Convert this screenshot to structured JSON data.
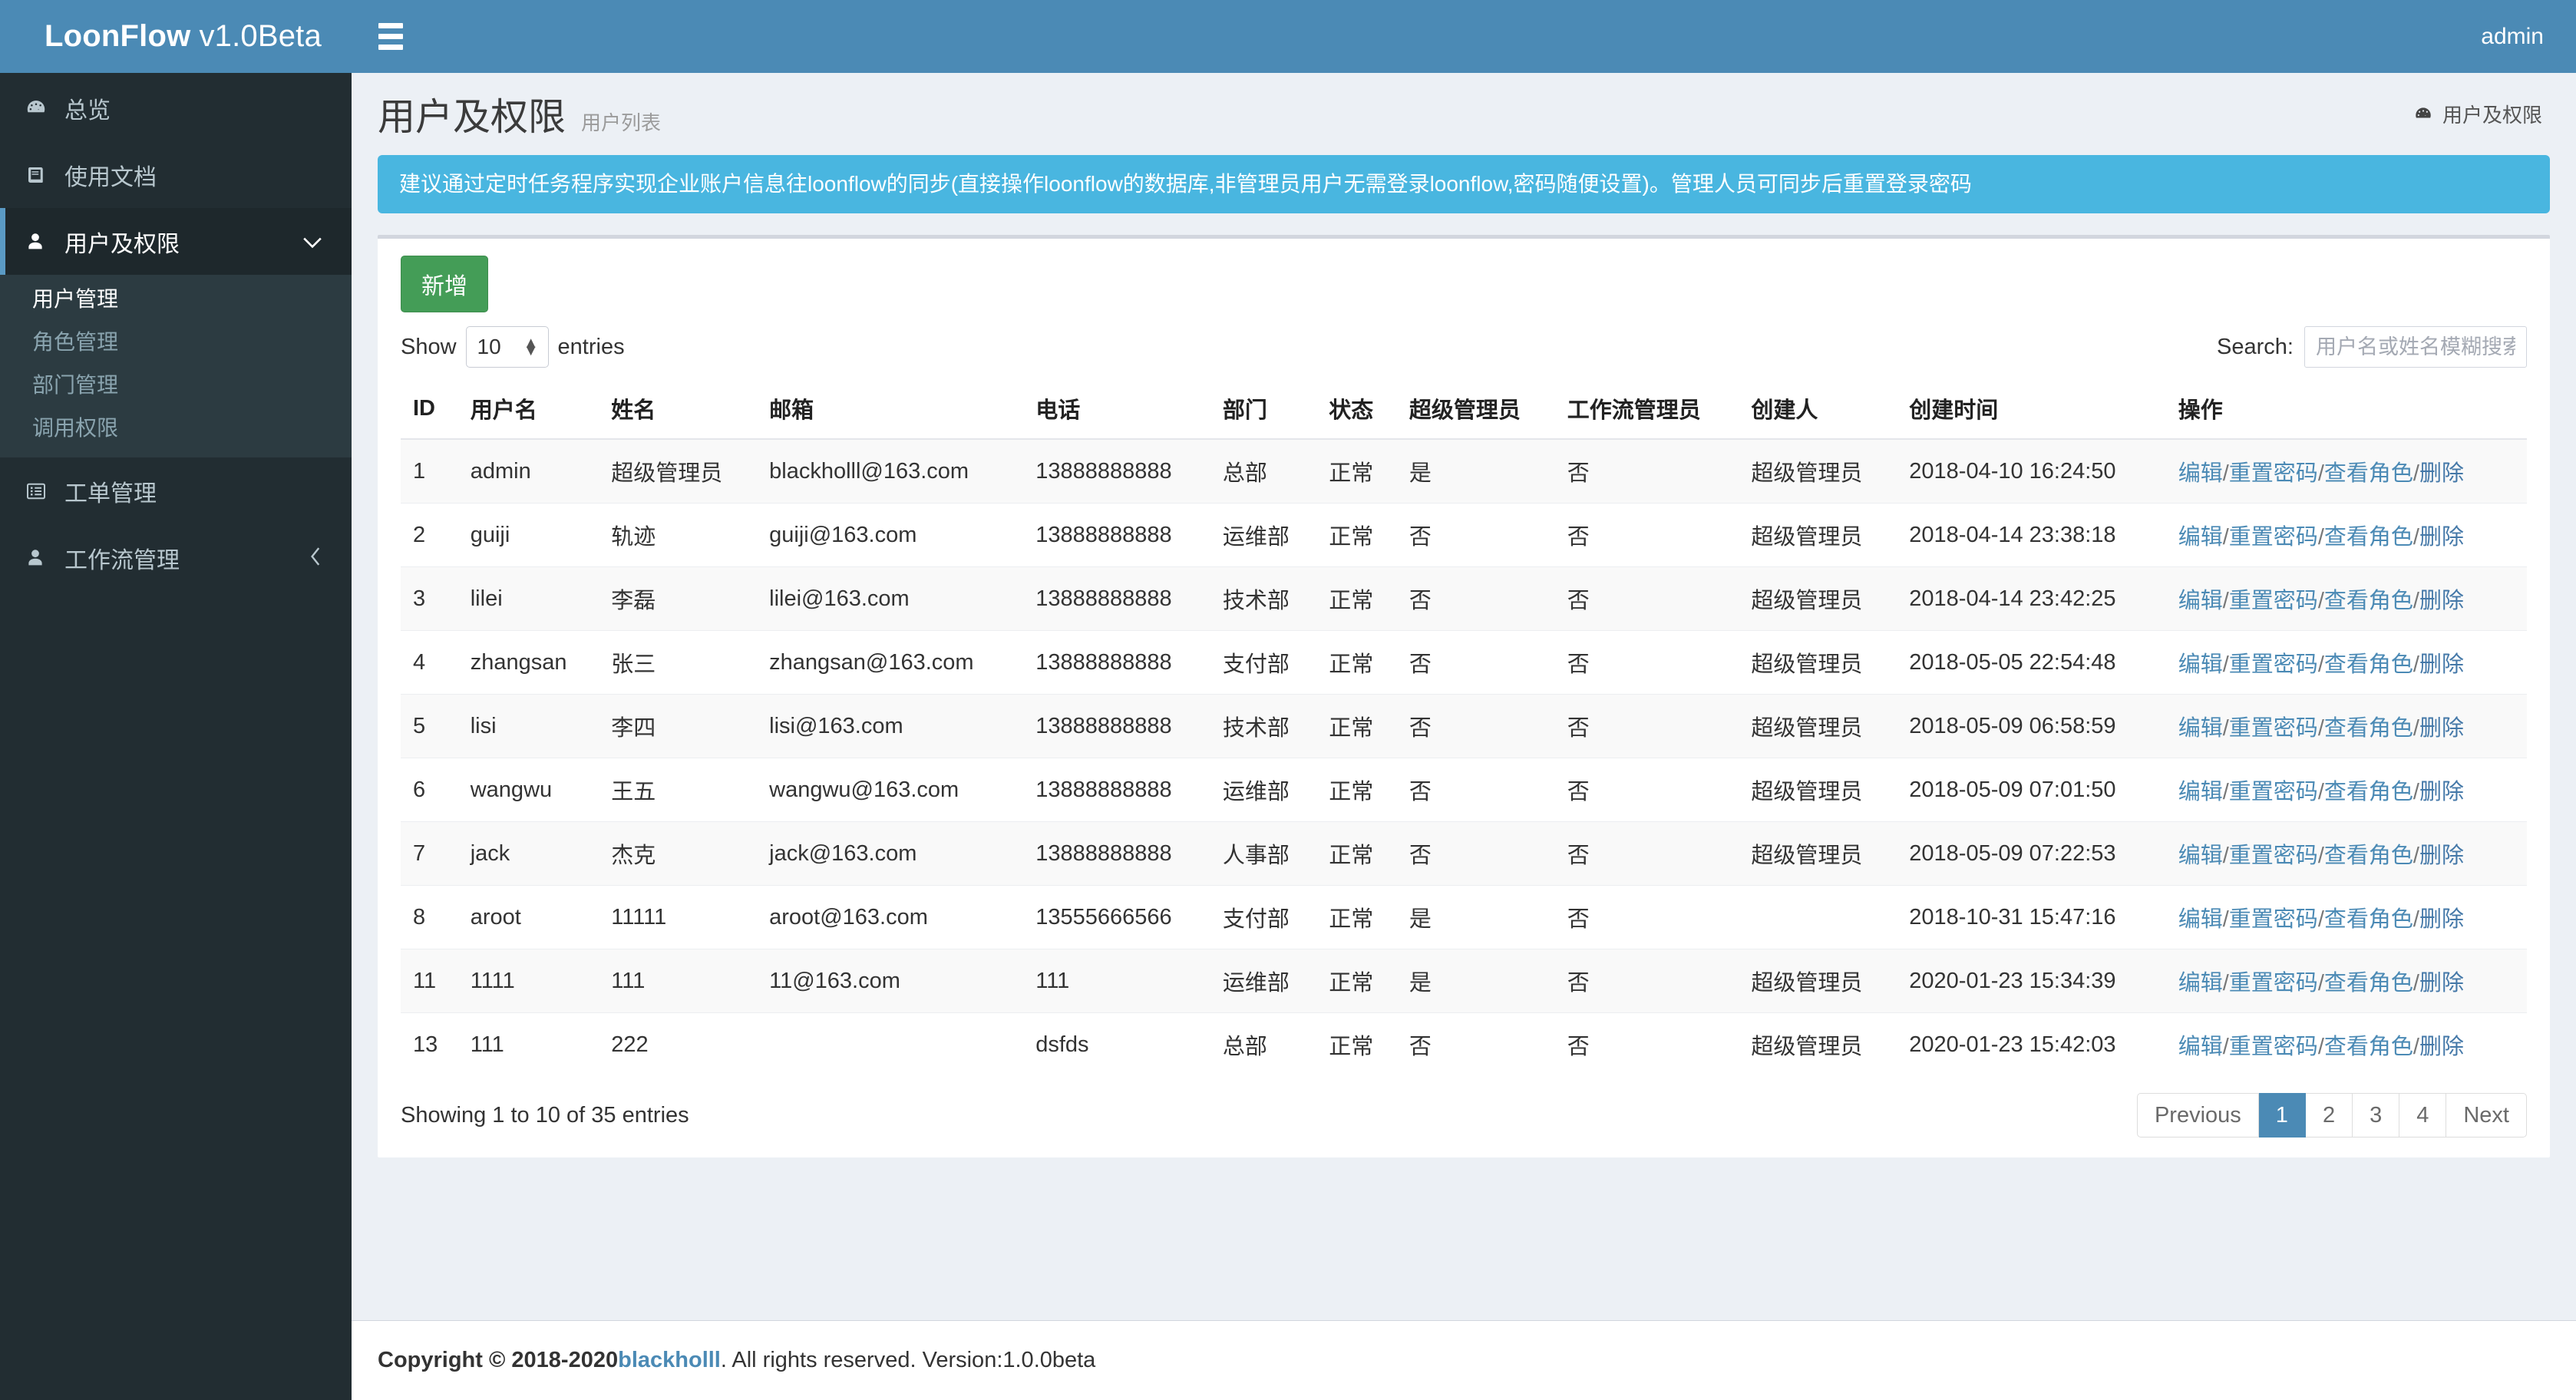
{
  "brand": {
    "name": "LoonFlow",
    "version": "v1.0Beta"
  },
  "navbar": {
    "user": "admin"
  },
  "sidebar": {
    "items": [
      {
        "label": "总览",
        "icon": "dashboard-icon",
        "state": "normal"
      },
      {
        "label": "使用文档",
        "icon": "book-icon",
        "state": "normal"
      },
      {
        "label": "用户及权限",
        "icon": "user-icon",
        "state": "active",
        "caret": "chevron-down"
      },
      {
        "label": "工单管理",
        "icon": "list-icon",
        "state": "normal"
      },
      {
        "label": "工作流管理",
        "icon": "user-icon",
        "state": "normal",
        "caret": "chevron-left"
      }
    ],
    "subitems": [
      {
        "label": "用户管理",
        "current": true
      },
      {
        "label": "角色管理",
        "current": false
      },
      {
        "label": "部门管理",
        "current": false
      },
      {
        "label": "调用权限",
        "current": false
      }
    ]
  },
  "page": {
    "title": "用户及权限",
    "subtitle": "用户列表",
    "breadcrumb": "用户及权限",
    "alert": "建议通过定时任务程序实现企业账户信息往loonflow的同步(直接操作loonflow的数据库,非管理员用户无需登录loonflow,密码随便设置)。管理人员可同步后重置登录密码"
  },
  "toolbar": {
    "add_label": "新增",
    "show_prefix": "Show",
    "show_value": "10",
    "show_suffix": "entries",
    "search_label": "Search:",
    "search_value": "",
    "search_placeholder": "用户名或姓名模糊搜索"
  },
  "table": {
    "columns": [
      "ID",
      "用户名",
      "姓名",
      "邮箱",
      "电话",
      "部门",
      "状态",
      "超级管理员",
      "工作流管理员",
      "创建人",
      "创建时间",
      "操作"
    ],
    "ops": {
      "edit": "编辑",
      "reset": "重置密码",
      "roles": "查看角色",
      "delete": "删除",
      "separator": "/"
    },
    "rows": [
      {
        "id": "1",
        "username": "admin",
        "name": "超级管理员",
        "email": "blackholll@163.com",
        "phone": "13888888888",
        "dept": "总部",
        "status": "正常",
        "is_super": "是",
        "is_wf_admin": "否",
        "creator": "超级管理员",
        "created": "2018-04-10 16:24:50"
      },
      {
        "id": "2",
        "username": "guiji",
        "name": "轨迹",
        "email": "guiji@163.com",
        "phone": "13888888888",
        "dept": "运维部",
        "status": "正常",
        "is_super": "否",
        "is_wf_admin": "否",
        "creator": "超级管理员",
        "created": "2018-04-14 23:38:18"
      },
      {
        "id": "3",
        "username": "lilei",
        "name": "李磊",
        "email": "lilei@163.com",
        "phone": "13888888888",
        "dept": "技术部",
        "status": "正常",
        "is_super": "否",
        "is_wf_admin": "否",
        "creator": "超级管理员",
        "created": "2018-04-14 23:42:25"
      },
      {
        "id": "4",
        "username": "zhangsan",
        "name": "张三",
        "email": "zhangsan@163.com",
        "phone": "13888888888",
        "dept": "支付部",
        "status": "正常",
        "is_super": "否",
        "is_wf_admin": "否",
        "creator": "超级管理员",
        "created": "2018-05-05 22:54:48"
      },
      {
        "id": "5",
        "username": "lisi",
        "name": "李四",
        "email": "lisi@163.com",
        "phone": "13888888888",
        "dept": "技术部",
        "status": "正常",
        "is_super": "否",
        "is_wf_admin": "否",
        "creator": "超级管理员",
        "created": "2018-05-09 06:58:59"
      },
      {
        "id": "6",
        "username": "wangwu",
        "name": "王五",
        "email": "wangwu@163.com",
        "phone": "13888888888",
        "dept": "运维部",
        "status": "正常",
        "is_super": "否",
        "is_wf_admin": "否",
        "creator": "超级管理员",
        "created": "2018-05-09 07:01:50"
      },
      {
        "id": "7",
        "username": "jack",
        "name": "杰克",
        "email": "jack@163.com",
        "phone": "13888888888",
        "dept": "人事部",
        "status": "正常",
        "is_super": "否",
        "is_wf_admin": "否",
        "creator": "超级管理员",
        "created": "2018-05-09 07:22:53"
      },
      {
        "id": "8",
        "username": "aroot",
        "name": "11111",
        "email": "aroot@163.com",
        "phone": "13555666566",
        "dept": "支付部",
        "status": "正常",
        "is_super": "是",
        "is_wf_admin": "否",
        "creator": "",
        "created": "2018-10-31 15:47:16"
      },
      {
        "id": "11",
        "username": "1111",
        "name": "111",
        "email": "11@163.com",
        "phone": "111",
        "dept": "运维部",
        "status": "正常",
        "is_super": "是",
        "is_wf_admin": "否",
        "creator": "超级管理员",
        "created": "2020-01-23 15:34:39"
      },
      {
        "id": "13",
        "username": "111",
        "name": "222",
        "email": "",
        "phone": "dsfds",
        "dept": "总部",
        "status": "正常",
        "is_super": "否",
        "is_wf_admin": "否",
        "creator": "超级管理员",
        "created": "2020-01-23 15:42:03"
      }
    ],
    "info": "Showing 1 to 10 of 35 entries",
    "pagination": [
      {
        "label": "Previous",
        "active": false
      },
      {
        "label": "1",
        "active": true
      },
      {
        "label": "2",
        "active": false
      },
      {
        "label": "3",
        "active": false
      },
      {
        "label": "4",
        "active": false
      },
      {
        "label": "Next",
        "active": false
      }
    ]
  },
  "footer": {
    "copyright": "Copyright © 2018-2020 ",
    "author": "blackholll",
    "rest": ". All rights reserved. Version:1.0.0beta"
  },
  "colors": {
    "brand_blue": "#4b8ab5",
    "sidebar_dark": "#222d32",
    "alert_blue": "#49b6e0",
    "add_green": "#449d57",
    "link_blue": "#4b8ab5"
  }
}
